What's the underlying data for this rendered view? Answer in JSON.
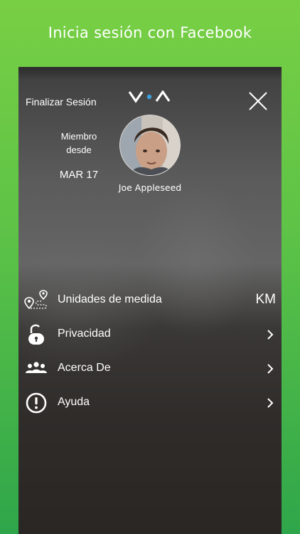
{
  "promo": {
    "headline": "Inicia sesión con Facebook"
  },
  "header": {
    "logout_label": "Finalizar Sesión",
    "logo_icon": "va-logo-icon",
    "close_icon": "close-icon"
  },
  "profile": {
    "member_label": "Miembro desde",
    "member_since": "MAR 17",
    "name": "Joe Appleseed"
  },
  "menu": {
    "items": [
      {
        "label": "Unidades de medida",
        "value": "KM",
        "icon": "route-pin-icon"
      },
      {
        "label": "Privacidad",
        "icon": "unlocked-padlock-icon"
      },
      {
        "label": "Acerca De",
        "icon": "group-icon"
      },
      {
        "label": "Ayuda",
        "icon": "exclamation-circle-icon"
      }
    ]
  },
  "colors": {
    "background_top": "#78cf44",
    "background_bottom": "#2fa64a",
    "text": "#ffffff",
    "logo_accent": "#3aa0e0"
  }
}
